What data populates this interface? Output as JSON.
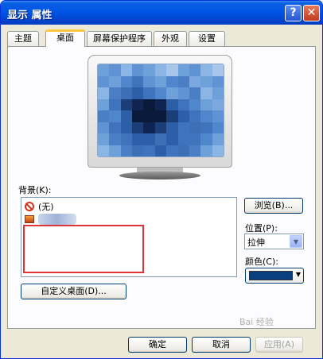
{
  "window": {
    "title": "显示 属性",
    "help_label": "?",
    "close_label": "✕"
  },
  "tabs": [
    {
      "label": "主题",
      "active": false
    },
    {
      "label": "桌面",
      "active": true
    },
    {
      "label": "屏幕保护程序",
      "active": false
    },
    {
      "label": "外观",
      "active": false
    },
    {
      "label": "设置",
      "active": false
    }
  ],
  "background": {
    "label": "背景(K):",
    "items": [
      {
        "label": "(无)",
        "icon": "no-symbol-icon"
      },
      {
        "label": "",
        "icon": "image-file-icon"
      }
    ],
    "browse_label": "浏览(B)..."
  },
  "position": {
    "label": "位置(P):",
    "value": "拉伸"
  },
  "color": {
    "label": "颜色(C):",
    "value": "#0a3f7f"
  },
  "customize_label": "自定义桌面(D)...",
  "footer": {
    "ok_label": "确定",
    "cancel_label": "取消",
    "apply_label": "应用(A)"
  },
  "watermark_text": "Bai 经验"
}
